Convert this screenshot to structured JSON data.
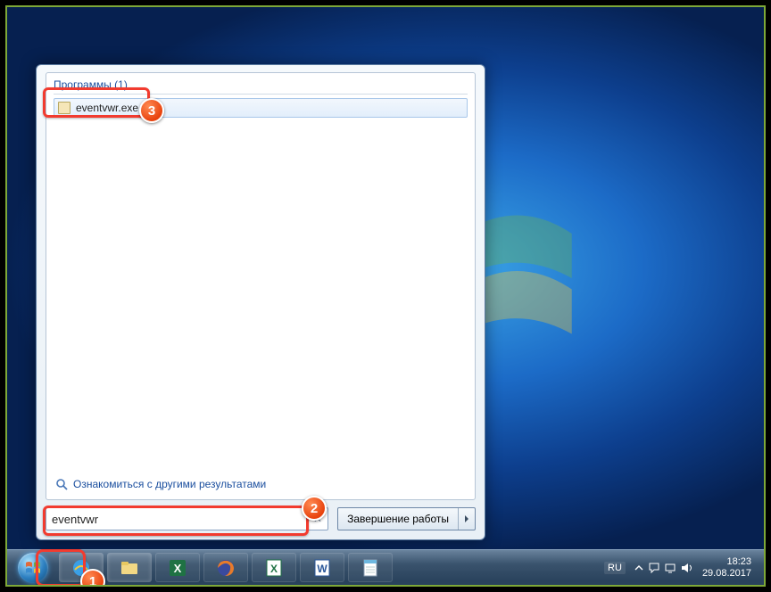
{
  "start_menu": {
    "section_header": "Программы (1)",
    "result_item": "eventvwr.exe",
    "more_results": "Ознакомиться с другими результатами",
    "search_value": "eventvwr",
    "shutdown_label": "Завершение работы"
  },
  "taskbar": {
    "items": [
      {
        "name": "internet-explorer"
      },
      {
        "name": "file-explorer"
      },
      {
        "name": "excel"
      },
      {
        "name": "firefox"
      },
      {
        "name": "excel-doc"
      },
      {
        "name": "word-doc"
      },
      {
        "name": "notepad"
      }
    ]
  },
  "tray": {
    "language": "RU",
    "time": "18:23",
    "date": "29.08.2017"
  },
  "annotations": {
    "b1": "1",
    "b2": "2",
    "b3": "3"
  },
  "colors": {
    "accent": "#f23b2f",
    "link": "#1a4e9e"
  }
}
